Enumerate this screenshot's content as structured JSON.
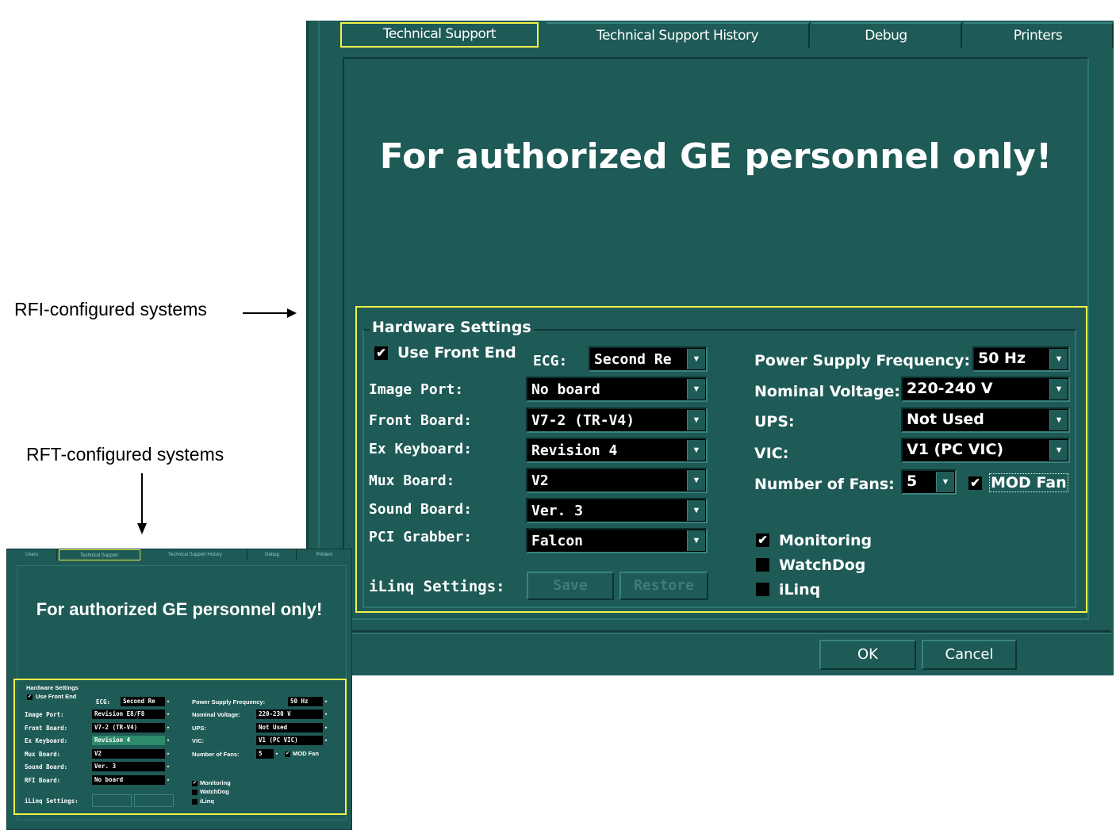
{
  "annotations": {
    "rfi_label": "RFI-configured systems",
    "rft_label": "RFT-configured systems"
  },
  "tabs": [
    {
      "label": "Technical Support",
      "active": true
    },
    {
      "label": "Technical Support History",
      "active": false
    },
    {
      "label": "Debug",
      "active": false
    },
    {
      "label": "Printers",
      "active": false
    }
  ],
  "warning_text": "For authorized GE personnel only!",
  "hardware": {
    "title": "Hardware Settings",
    "use_front_end": {
      "label": "Use Front End",
      "checked": true
    },
    "ecg": {
      "label": "ECG:",
      "value": "Second Re"
    },
    "image_port": {
      "label": "Image Port:",
      "value": "No board"
    },
    "front_board": {
      "label": "Front Board:",
      "value": "V7-2 (TR-V4)"
    },
    "ex_keyboard": {
      "label": "Ex Keyboard:",
      "value": "Revision 4"
    },
    "mux_board": {
      "label": "Mux Board:",
      "value": "V2"
    },
    "sound_board": {
      "label": "Sound Board:",
      "value": "Ver. 3"
    },
    "pci_grabber": {
      "label": "PCI Grabber:",
      "value": "Falcon"
    },
    "power_supply_frequency": {
      "label": "Power Supply Frequency:",
      "value": "50 Hz"
    },
    "nominal_voltage": {
      "label": "Nominal Voltage:",
      "value": "220-240 V"
    },
    "ups": {
      "label": "UPS:",
      "value": "Not Used"
    },
    "vic": {
      "label": "VIC:",
      "value": "V1 (PC VIC)"
    },
    "number_of_fans": {
      "label": "Number of Fans:",
      "value": "5"
    },
    "mod_fan": {
      "label": "MOD Fan",
      "checked": true
    },
    "monitoring": {
      "label": "Monitoring",
      "checked": true
    },
    "watchdog": {
      "label": "WatchDog",
      "checked": false
    },
    "ilinq": {
      "label": "iLinq",
      "checked": false
    },
    "ilinq_settings_label": "iLinq Settings:",
    "save_label": "Save",
    "restore_label": "Restore"
  },
  "footer": {
    "ok_label": "OK",
    "cancel_label": "Cancel"
  },
  "thumbnail": {
    "tabs": [
      "Users",
      "Technical Support",
      "Technical Support History",
      "Debug",
      "Printers"
    ],
    "warning_text": "For authorized GE personnel only!",
    "title": "Hardware Settings",
    "use_front_end": "Use Front End",
    "ecg_label": "ECG:",
    "ecg_value": "Second Re",
    "rows_left": [
      {
        "label": "Image Port:",
        "value": "Revision E8/F8"
      },
      {
        "label": "Front Board:",
        "value": "V7-2 (TR-V4)"
      },
      {
        "label": "Ex Keyboard:",
        "value": "Revision 4"
      },
      {
        "label": "Mux Board:",
        "value": "V2"
      },
      {
        "label": "Sound Board:",
        "value": "Ver. 3"
      },
      {
        "label": "RFI Board:",
        "value": "No board"
      }
    ],
    "psf_label": "Power Supply Frequency:",
    "psf_value": "50 Hz",
    "nv_label": "Nominal Voltage:",
    "nv_value": "220-230 V",
    "ups_label": "UPS:",
    "ups_value": "Not Used",
    "vic_label": "VIC:",
    "vic_value": "V1 (PC VIC)",
    "fans_label": "Number of Fans:",
    "fans_value": "5",
    "mod_fan": "MOD Fan",
    "monitoring": "Monitoring",
    "watchdog": "WatchDog",
    "ilinq": "iLinq",
    "ilinq_settings": "iLinq Settings:"
  }
}
